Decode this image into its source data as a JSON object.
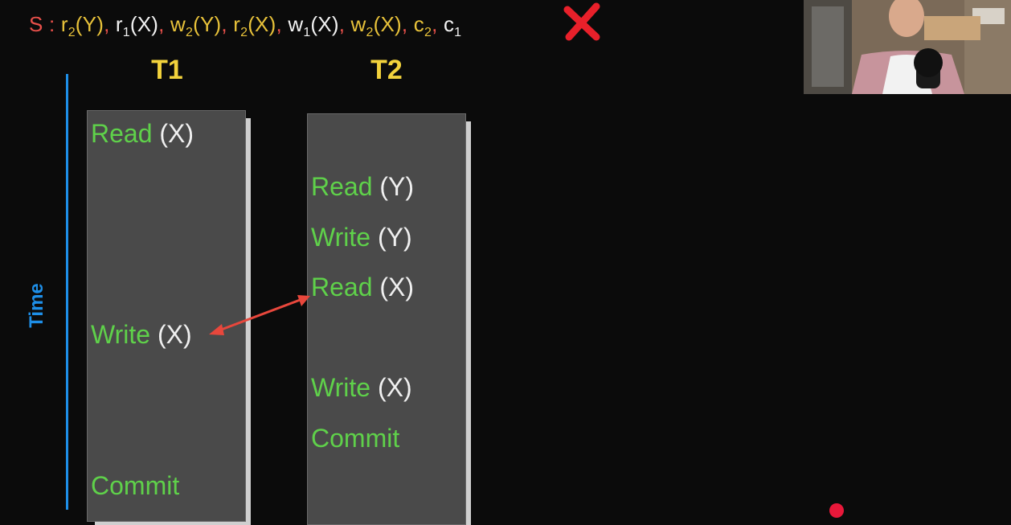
{
  "schedule": {
    "label": "S :",
    "ops": [
      {
        "op": "r",
        "tx": "2",
        "item": "(Y)",
        "color": "yellow"
      },
      {
        "op": "r",
        "tx": "1",
        "item": "(X)",
        "color": "white"
      },
      {
        "op": "w",
        "tx": "2",
        "item": "(Y)",
        "color": "yellow"
      },
      {
        "op": "r",
        "tx": "2",
        "item": "(X)",
        "color": "yellow"
      },
      {
        "op": "w",
        "tx": "1",
        "item": "(X)",
        "color": "white"
      },
      {
        "op": "w",
        "tx": "2",
        "item": "(X)",
        "color": "yellow"
      },
      {
        "op": "c",
        "tx": "2",
        "item": "",
        "color": "yellow"
      },
      {
        "op": "c",
        "tx": "1",
        "item": "",
        "color": "white"
      }
    ],
    "verdict_icon": "red-x-icon"
  },
  "timeline": {
    "axis_label": "Time"
  },
  "transactions": [
    {
      "title": "T1",
      "operations": [
        {
          "verb": "Read",
          "arg": "(X)"
        },
        {
          "verb": "Write",
          "arg": "(X)"
        },
        {
          "verb": "Commit",
          "arg": ""
        }
      ]
    },
    {
      "title": "T2",
      "operations": [
        {
          "verb": "Read",
          "arg": "(Y)"
        },
        {
          "verb": "Write",
          "arg": "(Y)"
        },
        {
          "verb": "Read",
          "arg": "(X)"
        },
        {
          "verb": "Write",
          "arg": "(X)"
        },
        {
          "verb": "Commit",
          "arg": ""
        }
      ]
    }
  ],
  "conflict": {
    "from": "T1 Write (X)",
    "to": "T2 Read (X)",
    "color": "#e8473c"
  },
  "colors": {
    "verb": "#5fd14a",
    "title": "#f2d23c",
    "axis": "#1e8fe8",
    "schedule_label": "#e8504a",
    "schedule_yellow": "#e8c23a",
    "schedule_white": "#f2f2f2"
  },
  "webcam": {
    "icon": "presenter-webcam-feed"
  }
}
